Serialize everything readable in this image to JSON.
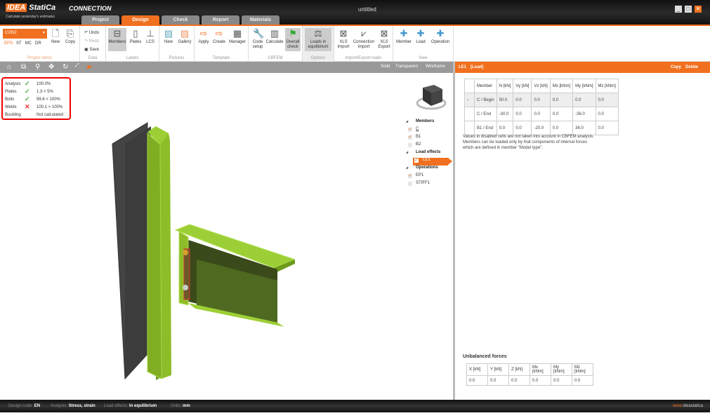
{
  "app": {
    "brand": "IDEA",
    "brand2": "StatiCa",
    "product": "CONNECTION",
    "tagline": "Calculate yesterday's estimates",
    "doc_title": "untitled"
  },
  "tabs": [
    "Project",
    "Design",
    "Check",
    "Report",
    "Materials"
  ],
  "ribbon": {
    "connection": "CON2",
    "modes": [
      "EPS",
      "ST",
      "MC",
      "DR"
    ],
    "new": "New",
    "copy": "Copy",
    "project_items": "Project items",
    "undo": "Undo",
    "redo": "Redo",
    "save": "Save",
    "data": "Data",
    "members": "Members",
    "plates": "Plates",
    "lcs": "LCS",
    "labels": "Labels",
    "pic_new": "New",
    "gallery": "Gallery",
    "pictures": "Pictures",
    "apply": "Apply",
    "create": "Create",
    "manager": "Manager",
    "template": "Template",
    "code_setup": "Code setup",
    "calculate": "Calculate",
    "overall_check": "Overall check",
    "cbfem": "CBFEM",
    "loads_eq": "Loads in equilibrium",
    "options": "Options",
    "xls_import": "XLS Import",
    "conn_import": "Connection import",
    "xls_export": "XLS Export",
    "import_export": "Import/Export loads",
    "member": "Member",
    "load": "Load",
    "operation": "Operation",
    "new_group": "New"
  },
  "toolbar": {
    "solid": "Solid",
    "transparent": "Transparent",
    "wireframe": "Wireframe"
  },
  "checks": [
    {
      "label": "Analysis",
      "status": "ok",
      "value": "100.0%"
    },
    {
      "label": "Plates",
      "status": "ok",
      "value": "1.3 < 5%"
    },
    {
      "label": "Bolts",
      "status": "ok",
      "value": "99.6 < 100%"
    },
    {
      "label": "Welds",
      "status": "fail",
      "value": "100.1 > 100%"
    },
    {
      "label": "Buckling",
      "status": "none",
      "value": "Not calculated"
    }
  ],
  "tree": {
    "members_h": "Members",
    "members": [
      "C",
      "B1",
      "B2"
    ],
    "load_h": "Load effects",
    "loads": [
      "LE1"
    ],
    "ops_h": "Operations",
    "ops": [
      "EP1",
      "STIFF1"
    ]
  },
  "panel": {
    "title": "LE1",
    "subtitle": "[Load]",
    "copy": "Copy",
    "delete": "Delete",
    "headers": [
      "Member",
      "N [kN]",
      "Vy [kN]",
      "Vz [kN]",
      "Mx [kNm]",
      "My [kNm]",
      "Mz [kNm]"
    ],
    "rows": [
      [
        "C / Begin",
        "50.0",
        "0.0",
        "0.0",
        "0.0",
        "0.0",
        "0.0"
      ],
      [
        "C / End",
        "-30.0",
        "0.0",
        "0.0",
        "0.0",
        "-36.0",
        "0.0"
      ],
      [
        "B1 / End",
        "0.0",
        "0.0",
        "-20.0",
        "0.0",
        "36.0",
        "0.0"
      ]
    ],
    "note": "Values in disabled cells are not taken into account in CBFEM analysis. Members can be loaded only by that components of internal forces which are defined in member \"Model type\".",
    "unbalanced_title": "Unbalanced forces",
    "ub_headers": [
      "X [kN]",
      "Y [kN]",
      "Z [kN]",
      "Mx [kNm]",
      "My [kNm]",
      "Mz [kNm]"
    ],
    "ub_values": [
      "0.0",
      "0.0",
      "0.0",
      "0.0",
      "0.0",
      "0.0"
    ]
  },
  "status": {
    "code_l": "Design code:",
    "code": "EN",
    "an_l": "Analysis:",
    "an": "Stress, strain",
    "le_l": "Load effects:",
    "le": "In equilibrium",
    "un_l": "Units:",
    "un": "mm",
    "url1": "www.",
    "url2": "ideastatica",
    ".com": ".com"
  }
}
